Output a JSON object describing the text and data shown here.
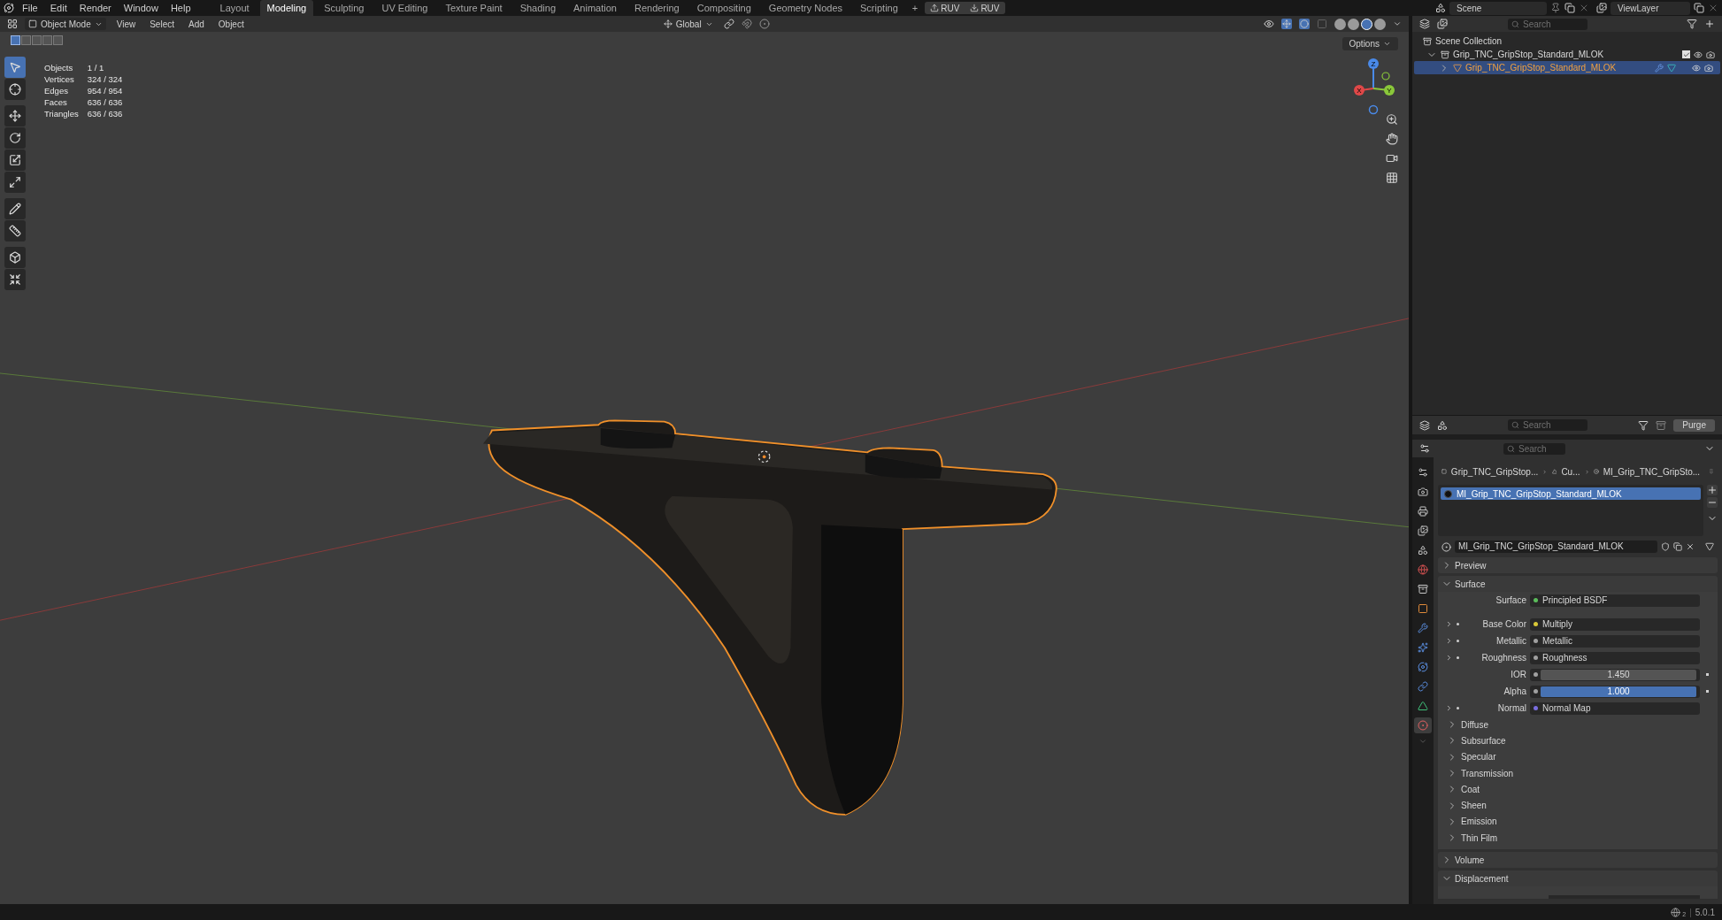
{
  "top_bar": {
    "menus": [
      "File",
      "Edit",
      "Render",
      "Window",
      "Help"
    ],
    "workspaces": [
      {
        "label": "Layout",
        "selected": false
      },
      {
        "label": "Modeling",
        "selected": true
      },
      {
        "label": "Sculpting",
        "selected": false
      },
      {
        "label": "UV Editing",
        "selected": false
      },
      {
        "label": "Texture Paint",
        "selected": false
      },
      {
        "label": "Shading",
        "selected": false
      },
      {
        "label": "Animation",
        "selected": false
      },
      {
        "label": "Rendering",
        "selected": false
      },
      {
        "label": "Compositing",
        "selected": false
      },
      {
        "label": "Geometry Nodes",
        "selected": false
      },
      {
        "label": "Scripting",
        "selected": false
      }
    ],
    "add_workspace": "+",
    "uv_buttons": [
      "RUV",
      "RUV"
    ],
    "scene": "Scene",
    "view_layer": "ViewLayer"
  },
  "viewport": {
    "mode": "Object Mode",
    "menus": [
      "View",
      "Select",
      "Add",
      "Object"
    ],
    "orientation": "Global",
    "options": "Options",
    "select_modes": [
      {
        "selected": true
      },
      {
        "selected": false
      },
      {
        "selected": false
      },
      {
        "selected": false
      },
      {
        "selected": false
      }
    ],
    "shading_modes": [
      {
        "selected": false
      },
      {
        "selected": false
      },
      {
        "selected": true
      },
      {
        "selected": false
      }
    ],
    "stats": [
      {
        "label": "Objects",
        "value": "1 / 1"
      },
      {
        "label": "Vertices",
        "value": "324 / 324"
      },
      {
        "label": "Edges",
        "value": "954 / 954"
      },
      {
        "label": "Faces",
        "value": "636 / 636"
      },
      {
        "label": "Triangles",
        "value": "636 / 636"
      }
    ],
    "tool_groups": [
      {
        "tools": [
          {
            "selected": true
          },
          {
            "selected": false
          }
        ]
      },
      {
        "tools": [
          {
            "selected": false
          },
          {
            "selected": false
          },
          {
            "selected": false
          },
          {
            "selected": false
          }
        ]
      },
      {
        "tools": [
          {
            "selected": false
          },
          {
            "selected": false
          }
        ]
      },
      {
        "tools": [
          {
            "selected": false
          },
          {
            "selected": false
          }
        ]
      }
    ],
    "gizmo_labels": [
      "X",
      "Y",
      "Z"
    ]
  },
  "outliner": {
    "search_placeholder": "Search",
    "root": "Scene Collection",
    "collections": [
      {
        "label": "Grip_TNC_GripStop_Standard_MLOK",
        "expanded": true,
        "checked": true,
        "children": [
          {
            "label": "Grip_TNC_GripStop_Standard_MLOK",
            "expanded": false,
            "selected": true
          }
        ]
      }
    ]
  },
  "data_api": {
    "search_placeholder": "Search",
    "purge": "Purge"
  },
  "properties": {
    "search_placeholder": "Search",
    "tabs": [
      {
        "selected": false
      },
      {
        "selected": false
      },
      {
        "selected": false
      },
      {
        "selected": false
      },
      {
        "selected": false
      },
      {
        "selected": false
      },
      {
        "selected": false
      },
      {
        "selected": false
      },
      {
        "selected": false
      },
      {
        "selected": false
      },
      {
        "selected": false
      },
      {
        "selected": false
      },
      {
        "selected": false
      },
      {
        "selected": true
      }
    ],
    "breadcrumb": [
      "Grip_TNC_GripStop...",
      "Cu...",
      "MI_Grip_TNC_GripSto..."
    ],
    "slots": [
      {
        "label": "MI_Grip_TNC_GripStop_Standard_MLOK",
        "selected": true
      }
    ],
    "material": "MI_Grip_TNC_GripStop_Standard_MLOK",
    "panels": [
      {
        "title": "Preview",
        "expanded": false
      },
      {
        "title": "Surface",
        "expanded": true,
        "rows": [
          {
            "kind": "link",
            "label": "Surface",
            "value": "Principled BSDF",
            "color": "#5bbd5b",
            "expandable": false
          },
          {
            "kind": "link",
            "label": "Base Color",
            "value": "Multiply",
            "color": "#d8c838",
            "expandable": true
          },
          {
            "kind": "link",
            "label": "Metallic",
            "value": "Metallic",
            "color": "#a0a0a0",
            "expandable": true
          },
          {
            "kind": "link",
            "label": "Roughness",
            "value": "Roughness",
            "color": "#a0a0a0",
            "expandable": true
          },
          {
            "kind": "number",
            "label": "IOR",
            "value": "1.450",
            "color": "#a0a0a0",
            "expandable": false
          },
          {
            "kind": "slider",
            "label": "Alpha",
            "value": "1.000",
            "color": "#a0a0a0",
            "expandable": false,
            "level": 1
          },
          {
            "kind": "link",
            "label": "Normal",
            "value": "Normal Map",
            "color": "#7a6ee0",
            "expandable": true
          }
        ],
        "subpanels": [
          {
            "title": "Diffuse",
            "expanded": false
          },
          {
            "title": "Subsurface",
            "expanded": false
          },
          {
            "title": "Specular",
            "expanded": false
          },
          {
            "title": "Transmission",
            "expanded": false
          },
          {
            "title": "Coat",
            "expanded": false
          },
          {
            "title": "Sheen",
            "expanded": false
          },
          {
            "title": "Emission",
            "expanded": false
          },
          {
            "title": "Thin Film",
            "expanded": false
          }
        ]
      },
      {
        "title": "Volume",
        "expanded": false
      },
      {
        "title": "Displacement",
        "expanded": true
      }
    ]
  },
  "status_bar": {
    "globe_badge": "2",
    "separator": "|",
    "version": "5.0.1"
  }
}
